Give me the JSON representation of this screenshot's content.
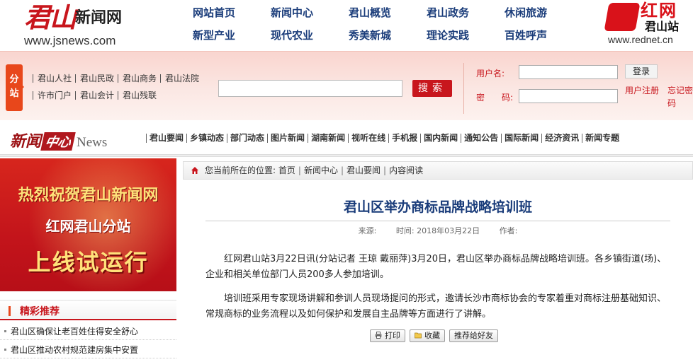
{
  "header": {
    "logo_main": "君山",
    "logo_sub": "新闻网",
    "logo_url": "www.jsnews.com",
    "nav": [
      "网站首页",
      "新闻中心",
      "君山概览",
      "君山政务",
      "休闲旅游",
      "新型产业",
      "现代农业",
      "秀美新城",
      "理论实践",
      "百姓呼声"
    ],
    "partner_name": "红网",
    "partner_station": "君山站",
    "partner_url": "www.rednet.cn"
  },
  "subbar": {
    "tag": "分站",
    "links_row1": [
      "君山人社",
      "君山民政",
      "君山商务",
      "君山法院"
    ],
    "links_row2": [
      "许市门户",
      "君山会计",
      "君山残联"
    ],
    "search": {
      "value": "",
      "placeholder": "",
      "button": "搜索"
    },
    "login": {
      "username_label": "用户名:",
      "password_label": "密　　码:",
      "login_button": "登录",
      "register_link": "用户注册",
      "forgot_link": "忘记密码"
    }
  },
  "channel": {
    "title_a": "新闻",
    "title_b": "中心",
    "title_c": "News",
    "nav": [
      "君山要闻",
      "乡镇动态",
      "部门动态",
      "图片新闻",
      "湖南新闻",
      "视听在线",
      "手机报",
      "国内新闻",
      "通知公告",
      "国际新闻",
      "经济资讯",
      "新闻专题"
    ]
  },
  "banner": {
    "line1": "热烈祝贺君山新闻网",
    "line2": "红网君山分站",
    "line3": "上线试运行"
  },
  "featured": {
    "title": "精彩推荐",
    "items": [
      "君山区确保让老百姓住得安全舒心",
      "君山区推动农村规范建房集中安置"
    ]
  },
  "breadcrumb": {
    "prefix": "您当前所在的位置:",
    "items": [
      "首页",
      "新闻中心",
      "君山要闻",
      "内容阅读"
    ]
  },
  "article": {
    "title": "君山区举办商标品牌战略培训班",
    "source_label": "来源:",
    "time_label": "时间:",
    "time_value": "2018年03月22日",
    "author_label": "作者:",
    "paragraphs": [
      "红网君山站3月22日讯(分站记者 王琼 戴丽萍)3月20日，君山区举办商标品牌战略培训班。各乡镇街道(场)、企业和相关单位部门人员200多人参加培训。",
      "培训班采用专家现场讲解和参训人员现场提问的形式，邀请长沙市商标协会的专家着重对商标注册基础知识、常规商标的业务流程以及如何保护和发展自主品牌等方面进行了讲解。"
    ],
    "actions": {
      "print": "打印",
      "favorite": "收藏",
      "share": "推荐给好友"
    }
  },
  "colors": {
    "brand_red": "#c8161d",
    "nav_blue": "#1a3c7a",
    "accent_orange": "#e8471b"
  }
}
